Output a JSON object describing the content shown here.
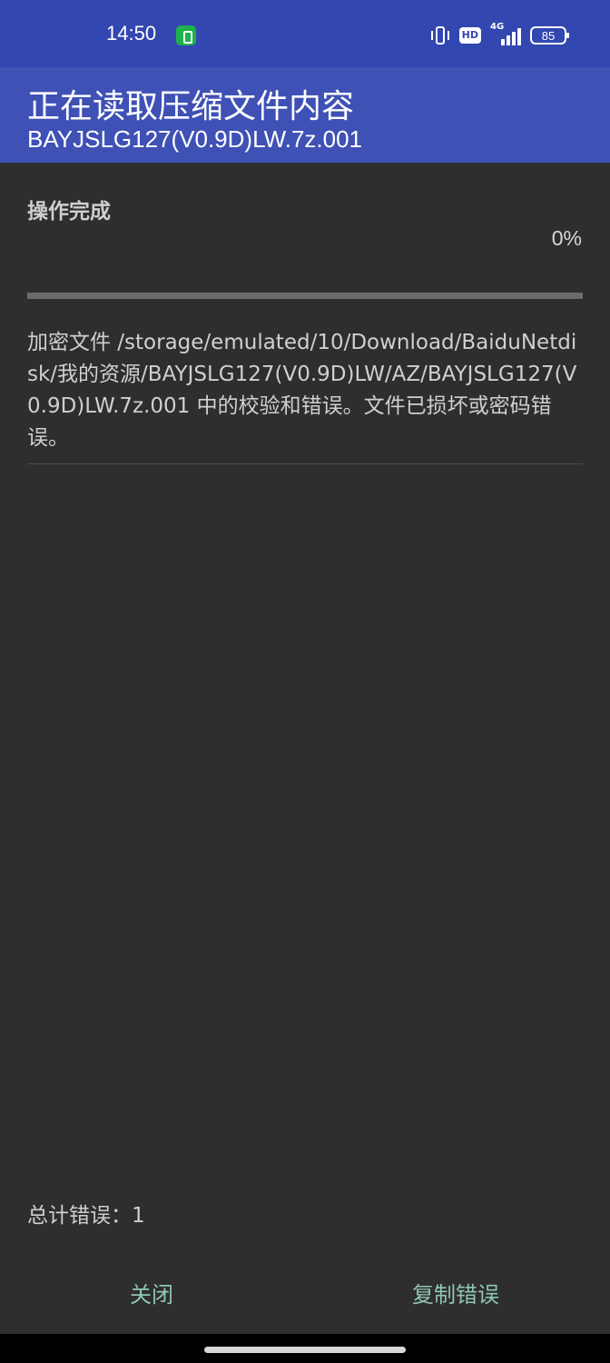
{
  "status_bar": {
    "time": "14:50",
    "hd_label": "HD",
    "network_label": "4G",
    "battery_level": "85"
  },
  "header": {
    "title": "正在读取压缩文件内容",
    "subtitle": "BAYJSLG127(V0.9D)LW.7z.001"
  },
  "progress": {
    "status_text": "操作完成",
    "percent_text": "0%",
    "value": 0
  },
  "errors": [
    {
      "message": "加密文件 /storage/emulated/10/Download/BaiduNetdisk/我的资源/BAYJSLG127(V0.9D)LW/AZ/BAYJSLG127(V0.9D)LW.7z.001 中的校验和错误。文件已损坏或密码错误。"
    }
  ],
  "footer": {
    "total_errors_text": "总计错误：1",
    "close_label": "关闭",
    "copy_errors_label": "复制错误"
  },
  "colors": {
    "status_bar_bg": "#3347b0",
    "title_bar_bg": "#3f51b5",
    "body_bg": "#2e2d30",
    "button_text": "#8ec7b2"
  }
}
